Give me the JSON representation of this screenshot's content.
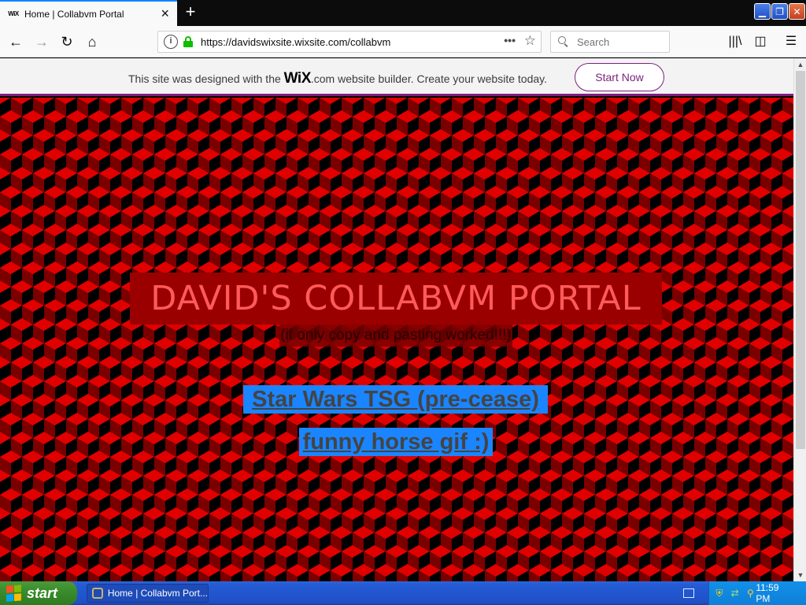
{
  "browser": {
    "tab": {
      "favicon": "WiX",
      "title": "Home | Collabvm Portal"
    },
    "url": "https://davidswixsite.wixsite.com/collabvm",
    "search_placeholder": "Search"
  },
  "wix_banner": {
    "text_before": "This site was designed with the ",
    "logo": "WiX",
    "text_after": ".com website builder. Create your website today.",
    "button": "Start Now",
    "accent_color": "#7d1f7e"
  },
  "page": {
    "title": "DAVID'S COLLABVM PORTAL",
    "subtitle": "(if only copy and pasting worked!!!)",
    "links": [
      "Star Wars TSG (pre-cease)",
      "funny horse gif :)"
    ],
    "colors": {
      "background_red": "#e00000",
      "title_box": "#9a0000",
      "link_highlight": "#1a85ff"
    }
  },
  "taskbar": {
    "start_label": "start",
    "task_item": "Home | Collabvm Port...",
    "clock": "11:59 PM"
  }
}
